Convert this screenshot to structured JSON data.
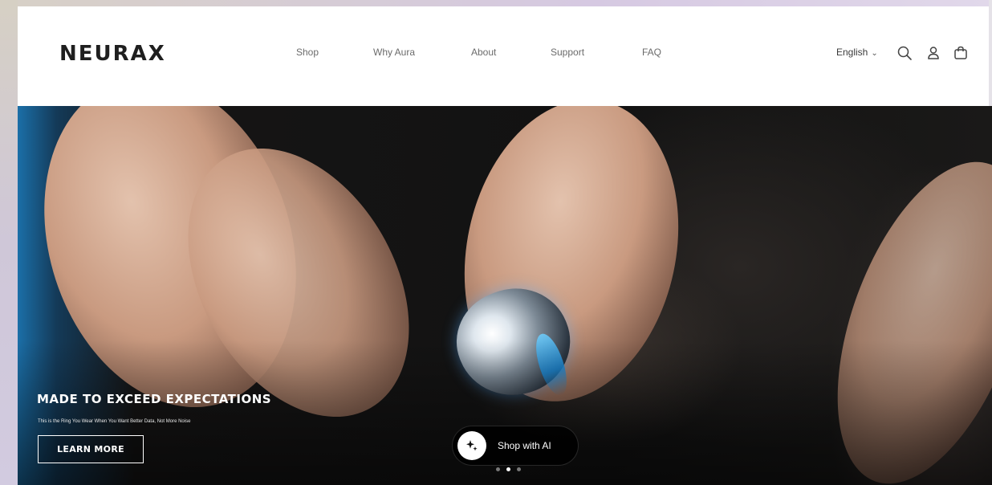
{
  "brand": {
    "logo_text": "NEURAX"
  },
  "nav": {
    "items": [
      {
        "label": "Shop"
      },
      {
        "label": "Why Aura"
      },
      {
        "label": "About"
      },
      {
        "label": "Support"
      },
      {
        "label": "FAQ"
      }
    ]
  },
  "header": {
    "language": "English",
    "icons": [
      "search-icon",
      "account-icon",
      "cart-icon"
    ]
  },
  "hero": {
    "heading": "MADE TO EXCEED EXPECTATIONS",
    "subheading": "This is the Ring You Wear When You Want Better Data, Not More Noise",
    "cta_label": "LEARN MORE",
    "slide_count": 3,
    "active_slide": 2
  },
  "shop_ai": {
    "label": "Shop with AI",
    "icon": "sparkle-icon"
  },
  "colors": {
    "header_bg": "#ffffff",
    "hero_text": "#ffffff",
    "nav_text": "#6b6b6b"
  }
}
